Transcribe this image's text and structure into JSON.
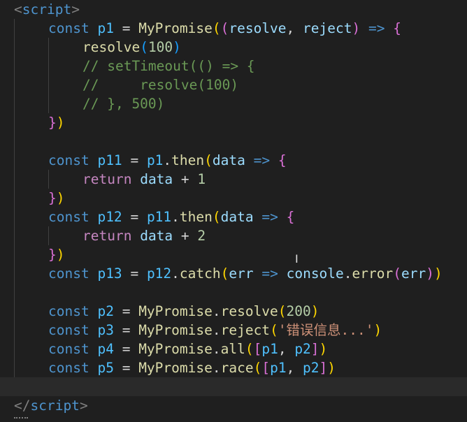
{
  "open_tag": {
    "lt": "<",
    "name": "script",
    "gt": ">"
  },
  "close_tag": {
    "lt": "</",
    "name": "script",
    "gt": ">"
  },
  "code": {
    "const_kw": "const",
    "return_kw": "return",
    "p1": "p1",
    "p11": "p11",
    "p12": "p12",
    "p13": "p13",
    "p2": "p2",
    "p3": "p3",
    "p4": "p4",
    "p5": "p5",
    "my_promise": "MyPromise",
    "resolve": "resolve",
    "reject": "reject",
    "then": "then",
    "catch": "catch",
    "all": "all",
    "race": "race",
    "data": "data",
    "err": "err",
    "console": "console",
    "error": "error",
    "num_100": "100",
    "num_1": "1",
    "num_2": "2",
    "num_200": "200",
    "error_msg": "'错误信息...'",
    "comment_1": "// setTimeout(() => {",
    "comment_2": "//     resolve(100)",
    "comment_3": "// }, 500)"
  }
}
